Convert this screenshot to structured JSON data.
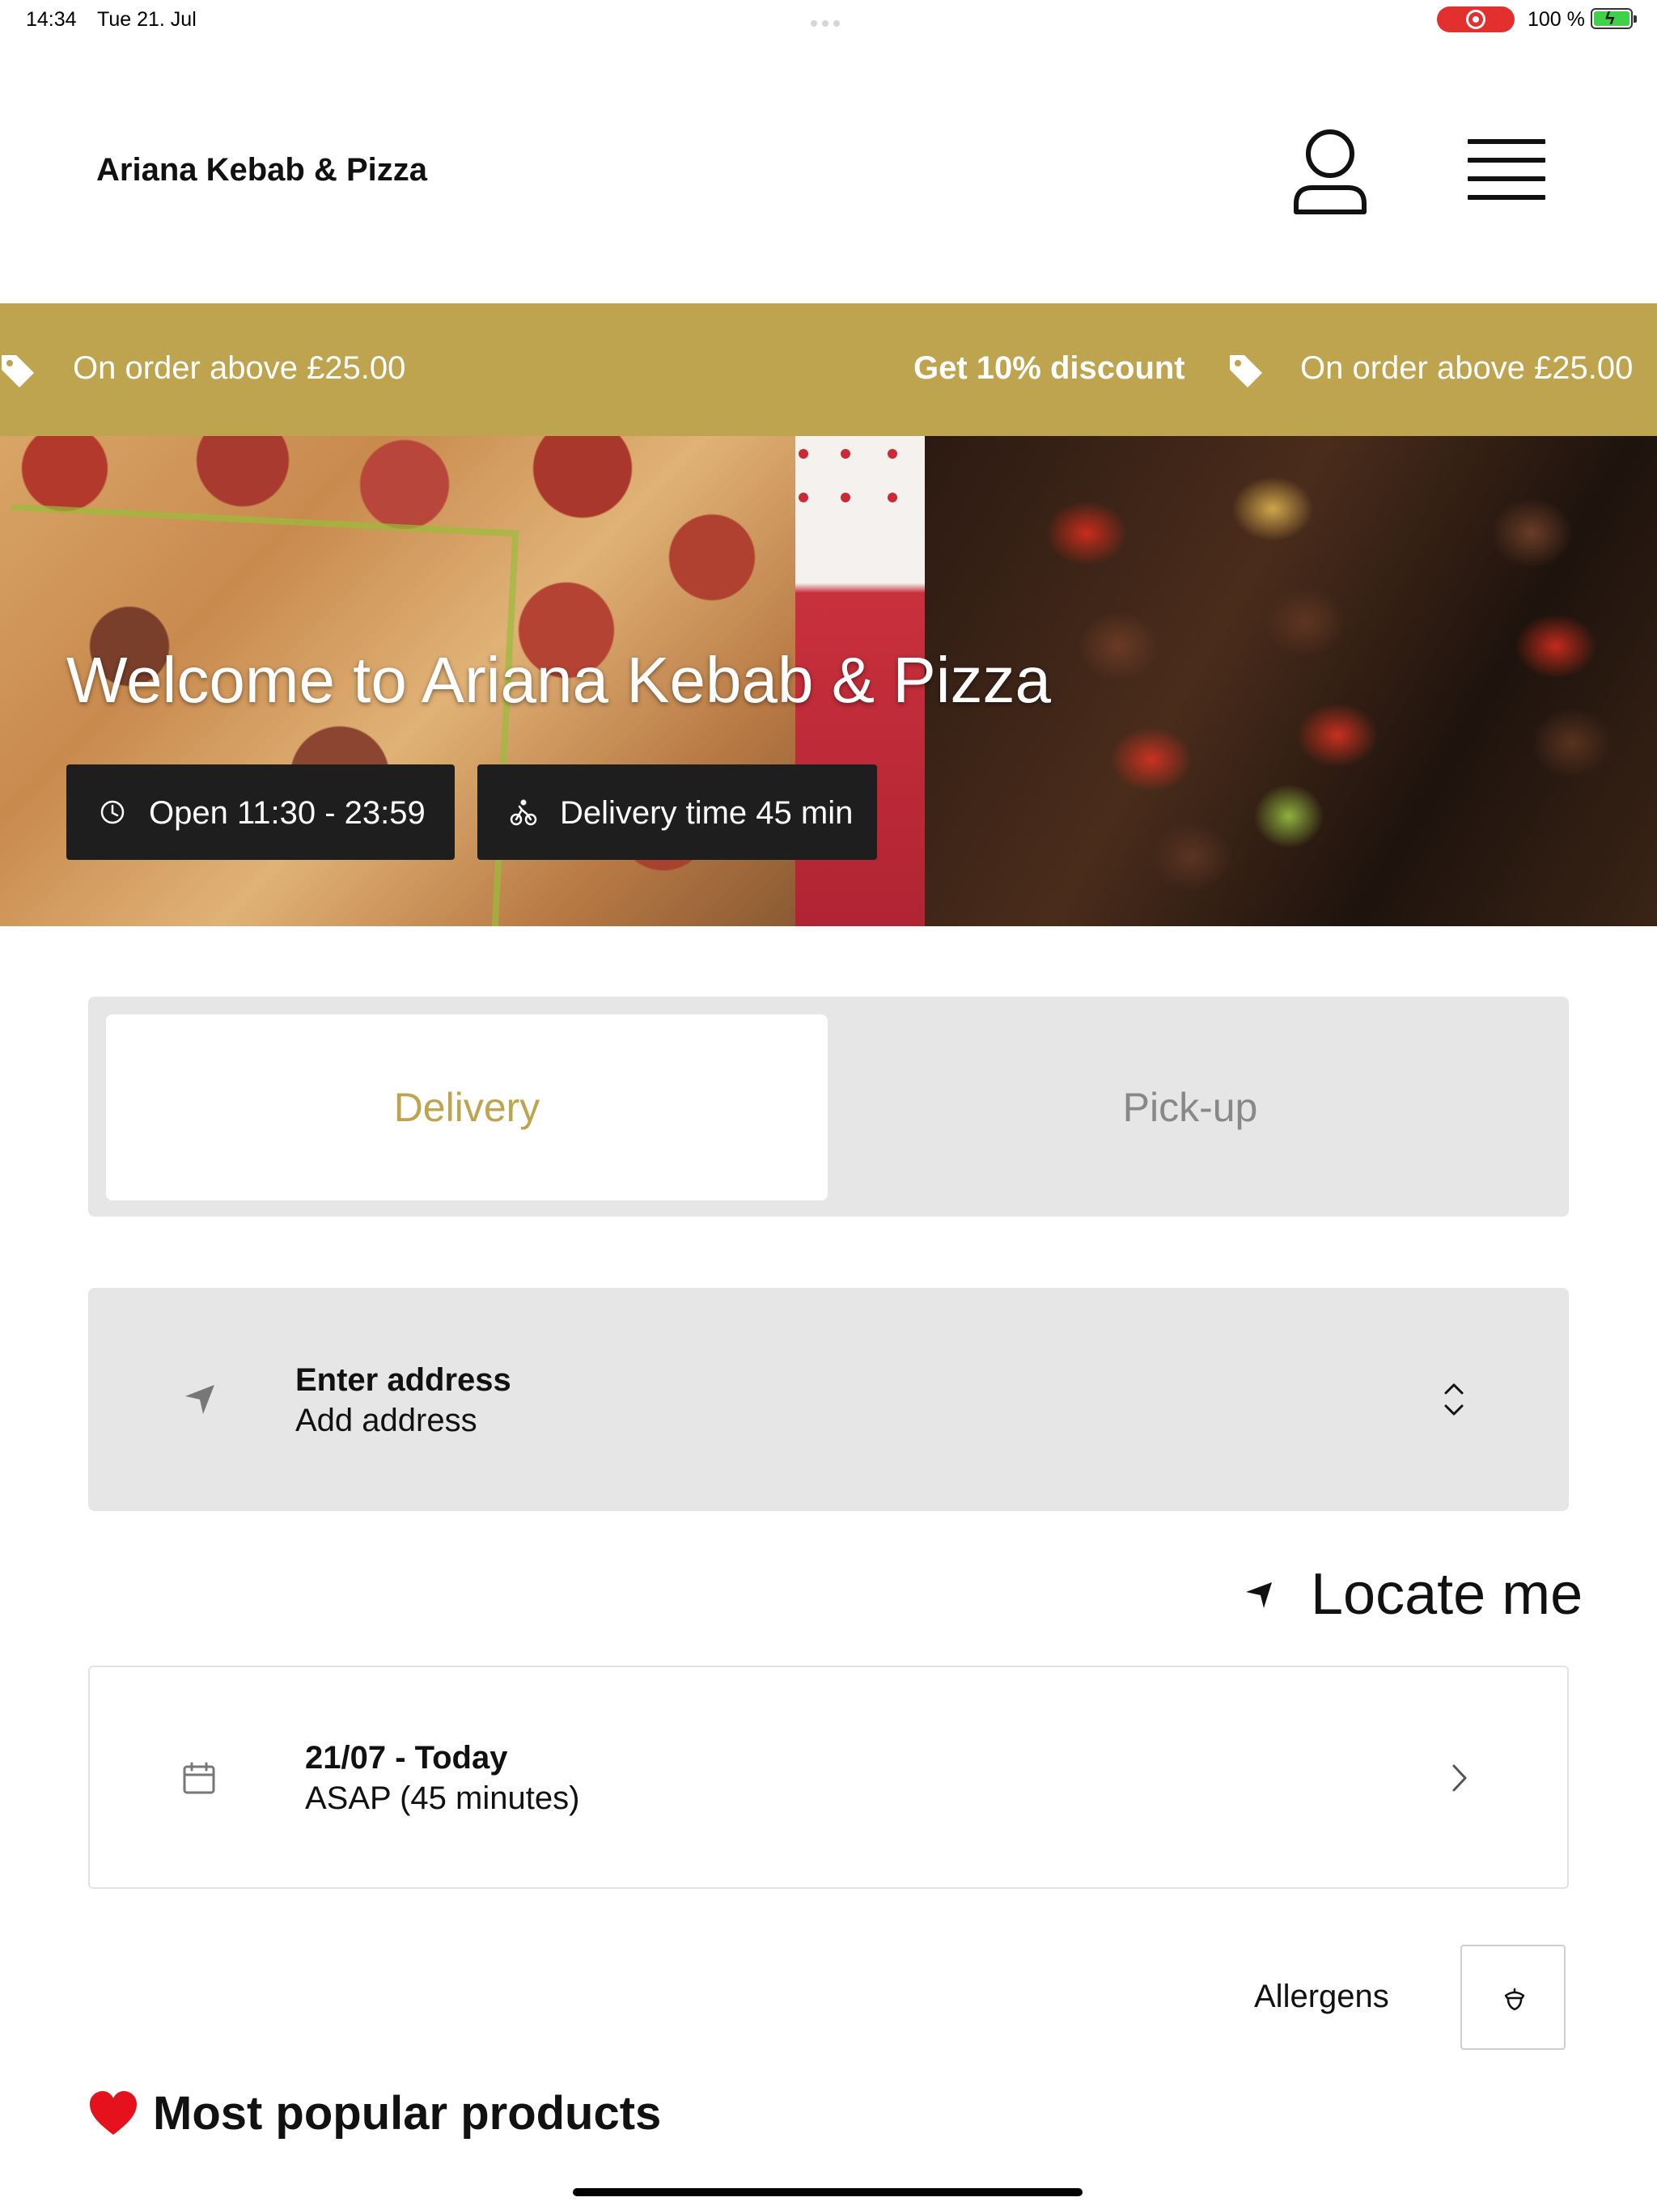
{
  "status_bar": {
    "time": "14:34",
    "date": "Tue 21. Jul",
    "battery": "100 %"
  },
  "header": {
    "brand": "Ariana Kebab & Pizza",
    "icons": [
      "user-icon",
      "hamburger-menu-icon"
    ]
  },
  "promo": {
    "text_1": "On order above £25.00",
    "text_2": "Get 10% discount",
    "text_3": "On order above £25.00",
    "background": "#bea44e"
  },
  "hero": {
    "title": "Welcome to Ariana Kebab & Pizza",
    "open_hours": "Open 11:30 - 23:59",
    "delivery_time": "Delivery time 45 min"
  },
  "order_mode": {
    "delivery_label": "Delivery",
    "pickup_label": "Pick-up",
    "selected": "Delivery",
    "accent": "#bea44e"
  },
  "address": {
    "title": "Enter address",
    "subtitle": "Add address"
  },
  "locate": {
    "label": "Locate me"
  },
  "schedule": {
    "date": "21/07 - Today",
    "time": "ASAP (45 minutes)"
  },
  "allergens": {
    "label": "Allergens"
  },
  "popular": {
    "title": "Most popular products"
  }
}
